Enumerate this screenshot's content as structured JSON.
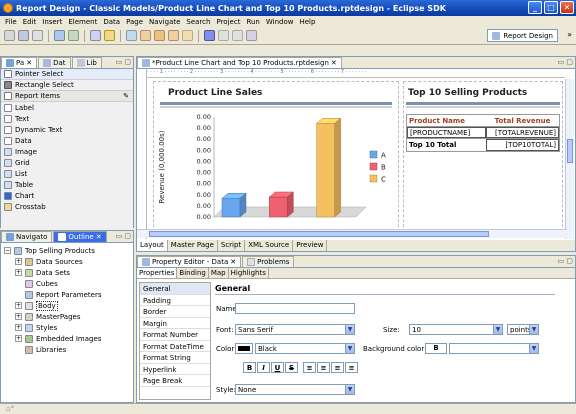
{
  "window": {
    "title": "Report Design - Classic Models/Product Line Chart and Top 10 Products.rptdesign - Eclipse SDK"
  },
  "menu": [
    "File",
    "Edit",
    "Insert",
    "Element",
    "Data",
    "Page",
    "Navigate",
    "Search",
    "Project",
    "Run",
    "Window",
    "Help"
  ],
  "perspective": {
    "label": "Report Design"
  },
  "palette": {
    "tabs": [
      "Pa",
      "Dat",
      "Lib"
    ],
    "tools": [
      "Pointer Select",
      "Rectangle Select"
    ],
    "section": "Report Items",
    "items": [
      "Label",
      "Text",
      "Dynamic Text",
      "Data",
      "Image",
      "Grid",
      "List",
      "Table",
      "Chart",
      "Crosstab"
    ]
  },
  "outline": {
    "tabs": [
      "Navigato",
      "Outline"
    ],
    "root": "Top Selling Products",
    "items": [
      "Data Sources",
      "Data Sets",
      "Cubes",
      "Report Parameters",
      "Body",
      "MasterPages",
      "Styles",
      "Embedded Images",
      "Libraries"
    ]
  },
  "editor": {
    "tab": "*Product Line Chart and Top 10 Products.rptdesign",
    "bottom_tabs": [
      "Layout",
      "Master Page",
      "Script",
      "XML Source",
      "Preview"
    ],
    "left_title": "Product Line Sales",
    "right_title": "Top 10 Selling Products",
    "table": {
      "headers": [
        "Product Name",
        "Total Revenue"
      ],
      "row": [
        "[PRODUCTNAME]",
        "[TOTALREVENUE]"
      ],
      "footer": [
        "Top 10 Total",
        "[TOP10TOTAL]"
      ]
    }
  },
  "chart_data": {
    "type": "bar",
    "ylabel": "Revenue (0,000.00s)",
    "tick_labels": [
      "0.00",
      "0.00",
      "0.00",
      "0.00",
      "0.00",
      "0.00",
      "0.00",
      "0.00",
      "0.00",
      "0.00"
    ],
    "series": [
      {
        "name": "A",
        "value": 1.5,
        "color": "#6aa6f0"
      },
      {
        "name": "B",
        "value": 1.6,
        "color": "#f06070"
      },
      {
        "name": "C",
        "value": 7.5,
        "color": "#f4c060"
      }
    ]
  },
  "properties": {
    "tabs": [
      "Property Editor - Data",
      "Problems"
    ],
    "subtabs": [
      "Properties",
      "Binding",
      "Map",
      "Highlights"
    ],
    "categories": [
      "General",
      "Padding",
      "Border",
      "Margin",
      "Format Number",
      "Format DateTime",
      "Format String",
      "Hyperlink",
      "Page Break"
    ],
    "section": "General",
    "name_label": "Name:",
    "name_value": "",
    "font_label": "Font:",
    "font_value": "Sans Serif",
    "size_label": "Size:",
    "size_value": "10",
    "size_unit": "points",
    "color_label": "Color:",
    "color_value": "Black",
    "bg_label": "Background color:",
    "bg_value": "",
    "style_label": "Style:",
    "style_value": "None",
    "format_buttons": [
      "B",
      "I",
      "U",
      "S"
    ]
  }
}
